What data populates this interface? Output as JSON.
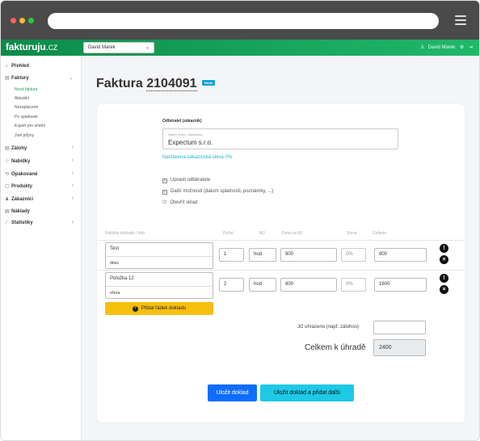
{
  "brand": {
    "name": "fakturuju",
    "tld": ".cz"
  },
  "header": {
    "user_select": "David Marek",
    "user_name": "David Marek"
  },
  "sidebar": {
    "items": [
      {
        "label": "Přehled"
      },
      {
        "label": "Faktury"
      },
      {
        "label": "Zálohy"
      },
      {
        "label": "Nabídky"
      },
      {
        "label": "Opakované"
      },
      {
        "label": "Produkty"
      },
      {
        "label": "Zákazníci"
      },
      {
        "label": "Náklady"
      },
      {
        "label": "Statistiky"
      }
    ],
    "sub_items": [
      "Nová faktura",
      "Aktuální",
      "Nezaplacené",
      "Po splatnosti",
      "Export pro účetní",
      "Jiné příjmy"
    ]
  },
  "page": {
    "title_prefix": "Faktura",
    "number": "2104091",
    "badge": "Nová"
  },
  "customer": {
    "section_label": "Odběratel (zákazník)",
    "field_placeholder": "Název firmy / zákazníka",
    "field_value": "Expectum s.r.o.",
    "discount_text": "Nastavena zákaznická sleva 0%"
  },
  "options": [
    "Upravit odběratele",
    "Další možnosti (datum splatnosti, poznámky, ...)",
    "Otevřít sklad"
  ],
  "table": {
    "headers": [
      "Položky dokladu / Info",
      "Počet",
      "MJ",
      "Cena za MJ",
      "Sleva",
      "Celkem"
    ],
    "rows": [
      {
        "name": "Test",
        "info": "dnes",
        "qty": "1",
        "unit": "hod",
        "price": "800",
        "discount": "0%",
        "total": "800"
      },
      {
        "name": "Položka 12",
        "info": "včera",
        "qty": "2",
        "unit": "hod",
        "price": "800",
        "discount": "0%",
        "total": "1600"
      }
    ],
    "add_row": "Přidat řádek dokladu"
  },
  "summary": {
    "paid_label": "Již uhrazeno (např. zálohou)",
    "paid_value": "",
    "total_label": "Celkem k úhradě",
    "total_value": "2400"
  },
  "actions": {
    "save": "Uložit doklad",
    "save_add": "Uložit doklad a přidat další"
  },
  "colors": {
    "brand_green": "#16a45a",
    "primary": "#0d6efd",
    "info": "#1ec9e6",
    "warning": "#f7bf0f",
    "badge": "#17a2d8"
  }
}
